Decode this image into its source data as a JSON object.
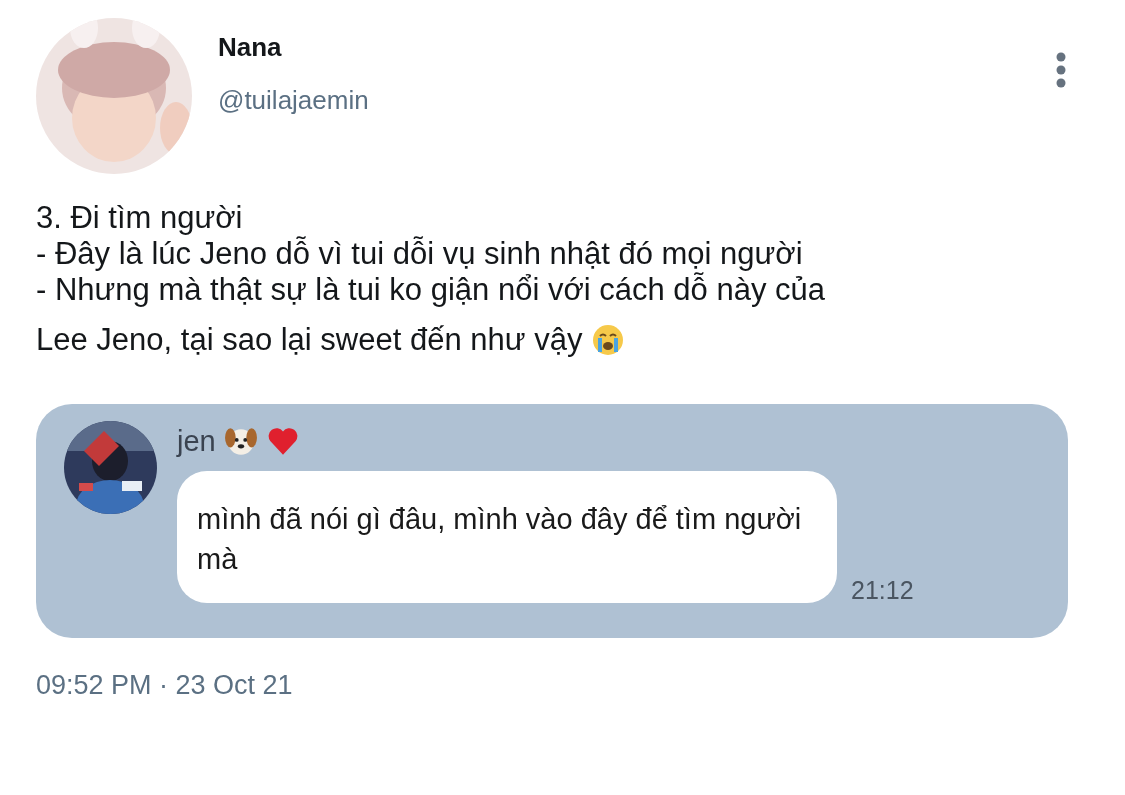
{
  "author": {
    "name": "Nana",
    "handle": "@tuilajaemin"
  },
  "body": {
    "lines": [
      "3. Đi tìm người",
      "- Đây là lúc Jeno dỗ vì tui dỗi vụ sinh nhật đó mọi người",
      "- Nhưng mà thật sự là tui ko giận nổi với cách dỗ này của",
      "Lee Jeno, tại sao lại sweet đến như vậy"
    ]
  },
  "attachment": {
    "sender": "jen",
    "message": "mình đã nói gì đâu, mình vào đây để tìm người mà",
    "time": "21:12"
  },
  "timestamp": "09:52 PM · 23 Oct 21"
}
